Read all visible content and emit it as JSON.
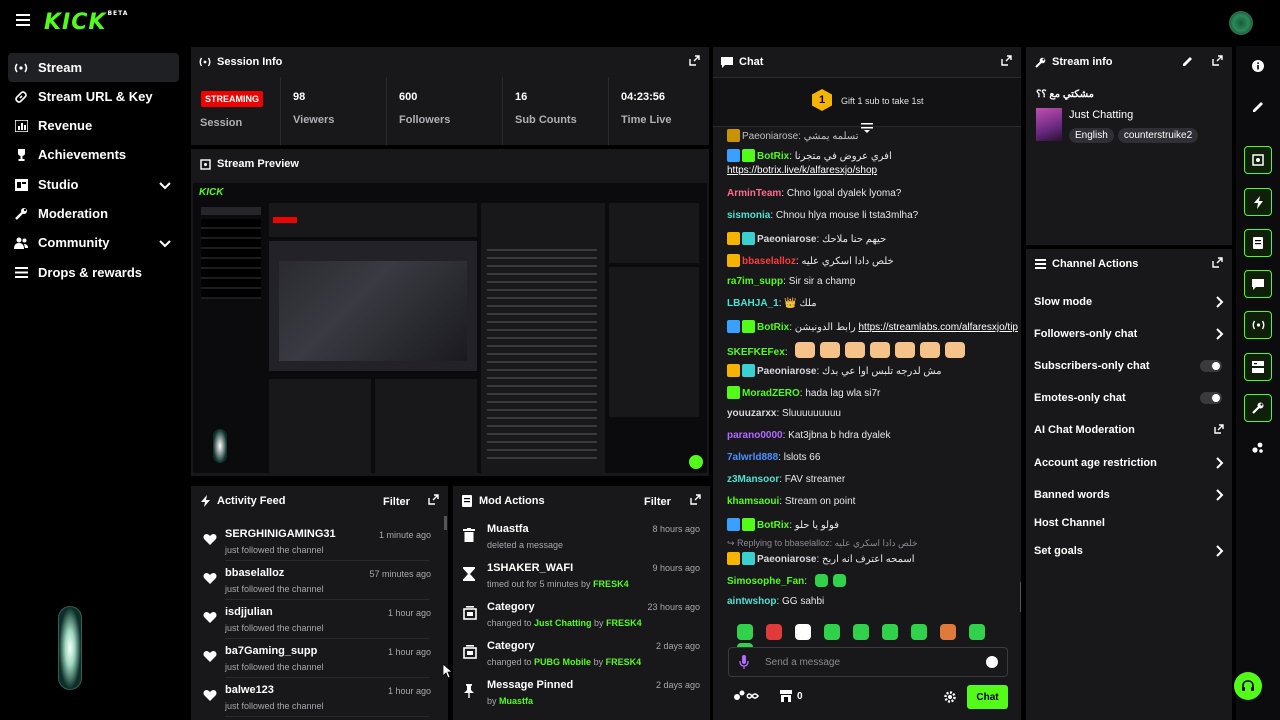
{
  "brand": {
    "logo_text": "KICK",
    "beta_label": "BETA"
  },
  "sidebar": {
    "items": [
      {
        "label": "Stream",
        "icon": "stream-icon"
      },
      {
        "label": "Stream URL & Key",
        "icon": "link-icon"
      },
      {
        "label": "Revenue",
        "icon": "chart-icon"
      },
      {
        "label": "Achievements",
        "icon": "trophy-icon"
      },
      {
        "label": "Studio",
        "icon": "studio-icon"
      },
      {
        "label": "Moderation",
        "icon": "wrench-icon"
      },
      {
        "label": "Community",
        "icon": "users-icon"
      },
      {
        "label": "Drops & rewards",
        "icon": "list-icon"
      }
    ]
  },
  "session": {
    "title": "Session Info",
    "badge": "STREAMING",
    "session_label": "Session",
    "stats": [
      {
        "value": "98",
        "label": "Viewers"
      },
      {
        "value": "600",
        "label": "Followers"
      },
      {
        "value": "16",
        "label": "Sub Counts"
      },
      {
        "value": "04:23:56",
        "label": "Time Live"
      }
    ]
  },
  "preview": {
    "title": "Stream Preview"
  },
  "activity": {
    "title": "Activity Feed",
    "filter": "Filter",
    "items": [
      {
        "user": "SERGHINIGAMING31",
        "action": "just followed the channel",
        "time": "1 minute ago"
      },
      {
        "user": "bbaselalloz",
        "action": "just followed the channel",
        "time": "57 minutes ago"
      },
      {
        "user": "isdjjulian",
        "action": "just followed the channel",
        "time": "1 hour ago"
      },
      {
        "user": "ba7Gaming_supp",
        "action": "just followed the channel",
        "time": "1 hour ago"
      },
      {
        "user": "balwe123",
        "action": "just followed the channel",
        "time": "1 hour ago"
      }
    ]
  },
  "mod": {
    "title": "Mod Actions",
    "filter": "Filter",
    "items": [
      {
        "title": "Muastfa",
        "pre": "deleted a message",
        "hl": "",
        "mid": "",
        "by": "",
        "time": "8 hours ago"
      },
      {
        "title": "1SHAKER_WAFI",
        "pre": "timed out for 5 minutes by ",
        "hl": "",
        "mid": "",
        "by": "FRESK4",
        "time": "9 hours ago"
      },
      {
        "title": "Category",
        "pre": "changed to ",
        "hl": "Just Chatting",
        "mid": " by ",
        "by": "FRESK4",
        "time": "23 hours ago"
      },
      {
        "title": "Category",
        "pre": "changed to ",
        "hl": "PUBG Mobile",
        "mid": " by ",
        "by": "FRESK4",
        "time": "2 days ago"
      },
      {
        "title": "Message Pinned",
        "pre": "by ",
        "hl": "",
        "mid": "",
        "by": "Muastfa",
        "time": "2 days ago"
      }
    ]
  },
  "chat": {
    "title": "Chat",
    "gift_rank": "1",
    "gift_text": "Gift 1 sub to take 1st",
    "top_partial": "Paeoniarose: تسلمه يمشي",
    "messages": [
      {
        "user": "BotRix",
        "color": "#53fc18",
        "text": "افري عروض في متجرنا ",
        "link": "https://botrix.live/k/alfaresxjo/shop",
        "badges": [
          "#3aa0ff",
          "#53fc18"
        ]
      },
      {
        "user": "ArminTeam",
        "color": "#ff6b8a",
        "text": "Chno lgoal dyalek lyoma?",
        "link": "",
        "badges": []
      },
      {
        "user": "sismonia",
        "color": "#4fe0d0",
        "text": "Chnou hlya mouse li tsta3mlha?",
        "link": "",
        "badges": []
      },
      {
        "user": "Paeoniarose",
        "color": "#d8d8dc",
        "text": "حيهم حنا ملاحك",
        "link": "",
        "badges": [
          "#f5b400",
          "#39d0d0"
        ]
      },
      {
        "user": "bbaselalloz",
        "color": "#ff3a3a",
        "text": "خلص دادا اسكري عليه",
        "link": "",
        "badges": [
          "#f5b400"
        ]
      },
      {
        "user": "ra7im_supp",
        "color": "#53fc18",
        "text": "Sir sir a champ",
        "link": "",
        "badges": []
      },
      {
        "user": "LBAHJA_1",
        "color": "#4fe0d0",
        "text": "👑 ملك",
        "link": "",
        "badges": []
      },
      {
        "user": "BotRix",
        "color": "#53fc18",
        "text": "رابط الدونيشن ",
        "link": "https://streamlabs.com/alfaresxjo/tip",
        "badges": [
          "#3aa0ff",
          "#53fc18"
        ]
      },
      {
        "user": "SKEFKEFex",
        "color": "#53fc18",
        "text": "",
        "link": "",
        "badges": [],
        "emotes": 7
      },
      {
        "user": "Paeoniarose",
        "color": "#d8d8dc",
        "text": "مش لدرجه تلبس اوا عي بدك",
        "link": "",
        "badges": [
          "#f5b400",
          "#39d0d0"
        ]
      },
      {
        "user": "MoradZERO",
        "color": "#53fc18",
        "text": "hada lag wla si7r",
        "link": "",
        "badges": [
          "#53fc18"
        ]
      },
      {
        "user": "youuzarxx",
        "color": "#d8d8dc",
        "text": "Sluuuuuuuuu",
        "link": "",
        "badges": []
      },
      {
        "user": "parano0000",
        "color": "#b06bff",
        "text": "Kat3jbna b hdra dyalek",
        "link": "",
        "badges": []
      },
      {
        "user": "7alwrld888",
        "color": "#4a90ff",
        "text": "lslots 66",
        "link": "",
        "badges": []
      },
      {
        "user": "z3Mansoor",
        "color": "#4fe0d0",
        "text": "FAV streamer",
        "link": "",
        "badges": []
      },
      {
        "user": "khamsaoui",
        "color": "#53fc18",
        "text": "Stream on point",
        "link": "",
        "badges": []
      },
      {
        "user": "BotRix",
        "color": "#53fc18",
        "text": "فولو يا حلو",
        "link": "",
        "badges": [
          "#3aa0ff",
          "#53fc18"
        ]
      }
    ],
    "reply_note": "Replying to bbaselalloz: خلص دادا اسكري عليه",
    "after_reply": [
      {
        "user": "Paeoniarose",
        "color": "#d8d8dc",
        "text": "اسمحه اعترف انه اربح",
        "link": "",
        "badges": [
          "#f5b400",
          "#39d0d0"
        ]
      },
      {
        "user": "Simosophe_Fan",
        "color": "#53fc18",
        "text": "",
        "link": "",
        "badges": [],
        "emotes": 2
      },
      {
        "user": "aintwshop",
        "color": "#4fe0d0",
        "text": "GG sahbi",
        "link": "",
        "badges": []
      }
    ],
    "input_placeholder": "Send a message",
    "count_value": "0",
    "chat_button": "Chat"
  },
  "stream_info": {
    "title": "Stream info",
    "stream_title": "مشكتي مع ؟؟",
    "category": "Just Chatting",
    "tags": [
      "English",
      "counterstruike2"
    ]
  },
  "channel_actions": {
    "title": "Channel Actions",
    "items": [
      {
        "label": "Slow mode",
        "kind": "arrow"
      },
      {
        "label": "Followers-only chat",
        "kind": "arrow"
      },
      {
        "label": "Subscribers-only chat",
        "kind": "toggle"
      },
      {
        "label": "Emotes-only chat",
        "kind": "toggle"
      },
      {
        "label": "AI Chat Moderation",
        "kind": "popout"
      },
      {
        "label": "Account age restriction",
        "kind": "arrow"
      },
      {
        "label": "Banned words",
        "kind": "arrow"
      },
      {
        "label": "Host Channel",
        "kind": "none"
      },
      {
        "label": "Set goals",
        "kind": "arrow"
      }
    ]
  },
  "colors": {
    "accent": "#53fc18",
    "panel": "#18181b",
    "live": "#eb0400"
  }
}
